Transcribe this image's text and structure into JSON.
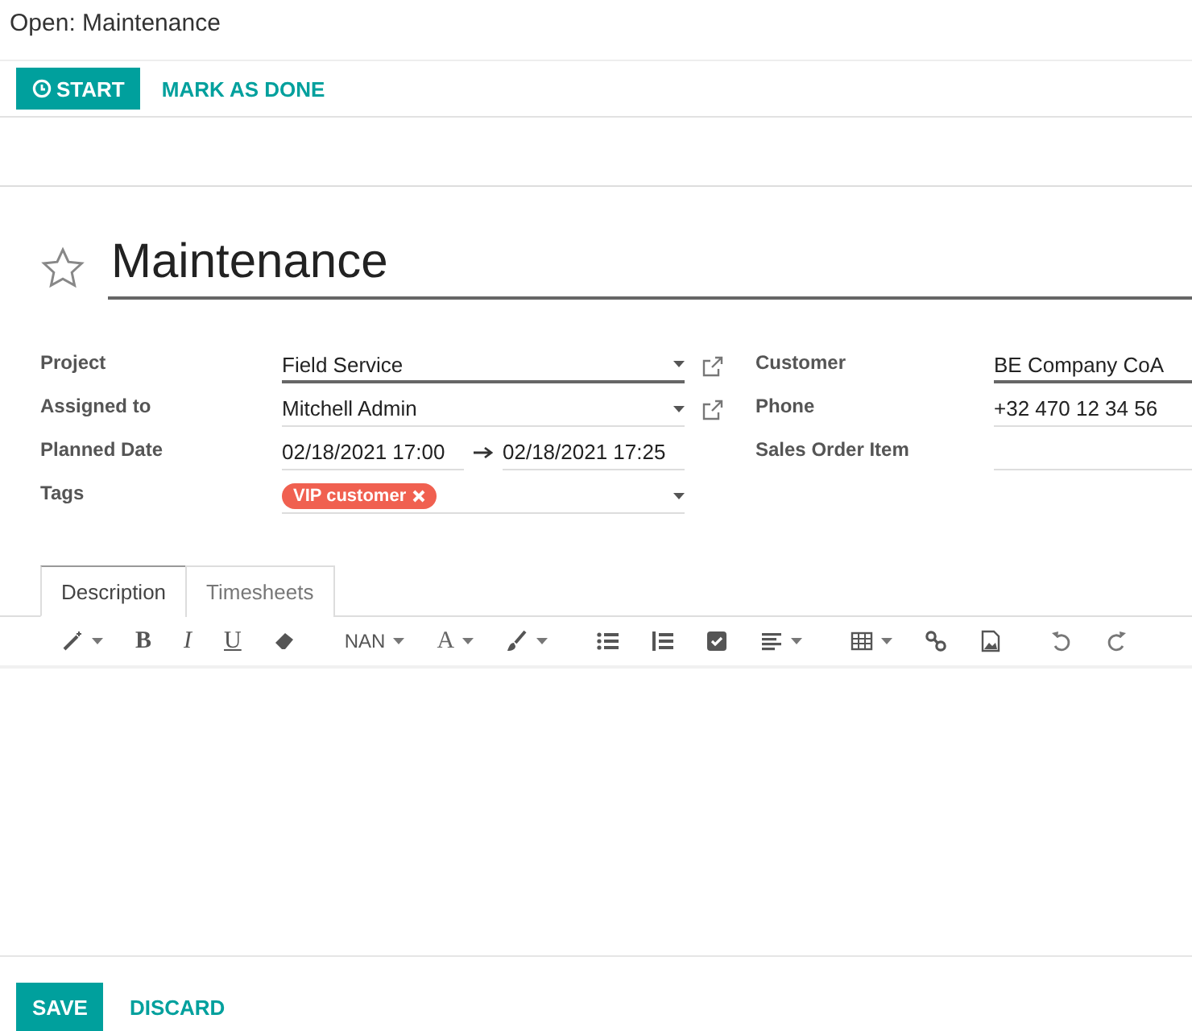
{
  "window": {
    "title": "Open: Maintenance"
  },
  "actions": [
    {
      "label": "START",
      "kind": "primary"
    },
    {
      "label": "MARK AS DONE",
      "kind": "link"
    }
  ],
  "task": {
    "name": "Maintenance",
    "starred": false
  },
  "fields_left": [
    {
      "label": "Project",
      "kind": "select",
      "value": "Field Service",
      "required": true,
      "external_link": true
    },
    {
      "label": "Assigned to",
      "kind": "select",
      "value": "Mitchell Admin",
      "required": false,
      "external_link": true
    },
    {
      "label": "Planned Date",
      "kind": "daterange",
      "start": "02/18/2021 17:00",
      "end": "02/18/2021 17:25"
    },
    {
      "label": "Tags",
      "kind": "tags",
      "tags": [
        {
          "label": "VIP customer",
          "color": "#f06050"
        }
      ]
    }
  ],
  "fields_right": [
    {
      "label": "Customer",
      "value": "BE Company CoA",
      "required": true
    },
    {
      "label": "Phone",
      "value": "+32 470 12 34 56",
      "required": false
    },
    {
      "label": "Sales Order Item",
      "required": false
    }
  ],
  "tabs": [
    {
      "label": "Description",
      "selected": true
    },
    {
      "label": "Timesheets",
      "selected": false
    }
  ],
  "toolbar": [
    {
      "kind": "wand"
    },
    {
      "kind": "bold",
      "label": "B"
    },
    {
      "kind": "italic",
      "label": "I"
    },
    {
      "kind": "underline",
      "label": "U"
    },
    {
      "kind": "eraser"
    },
    {
      "kind": "size",
      "label": "NAN"
    },
    {
      "kind": "color",
      "label": "A"
    },
    {
      "kind": "brush"
    },
    {
      "kind": "bullets"
    },
    {
      "kind": "numbers"
    },
    {
      "kind": "checklist"
    },
    {
      "kind": "align"
    },
    {
      "kind": "table"
    },
    {
      "kind": "link"
    },
    {
      "kind": "image"
    },
    {
      "kind": "undo"
    },
    {
      "kind": "redo"
    }
  ],
  "footer": [
    {
      "label": "SAVE",
      "kind": "primary"
    },
    {
      "label": "DISCARD",
      "kind": "link"
    }
  ]
}
